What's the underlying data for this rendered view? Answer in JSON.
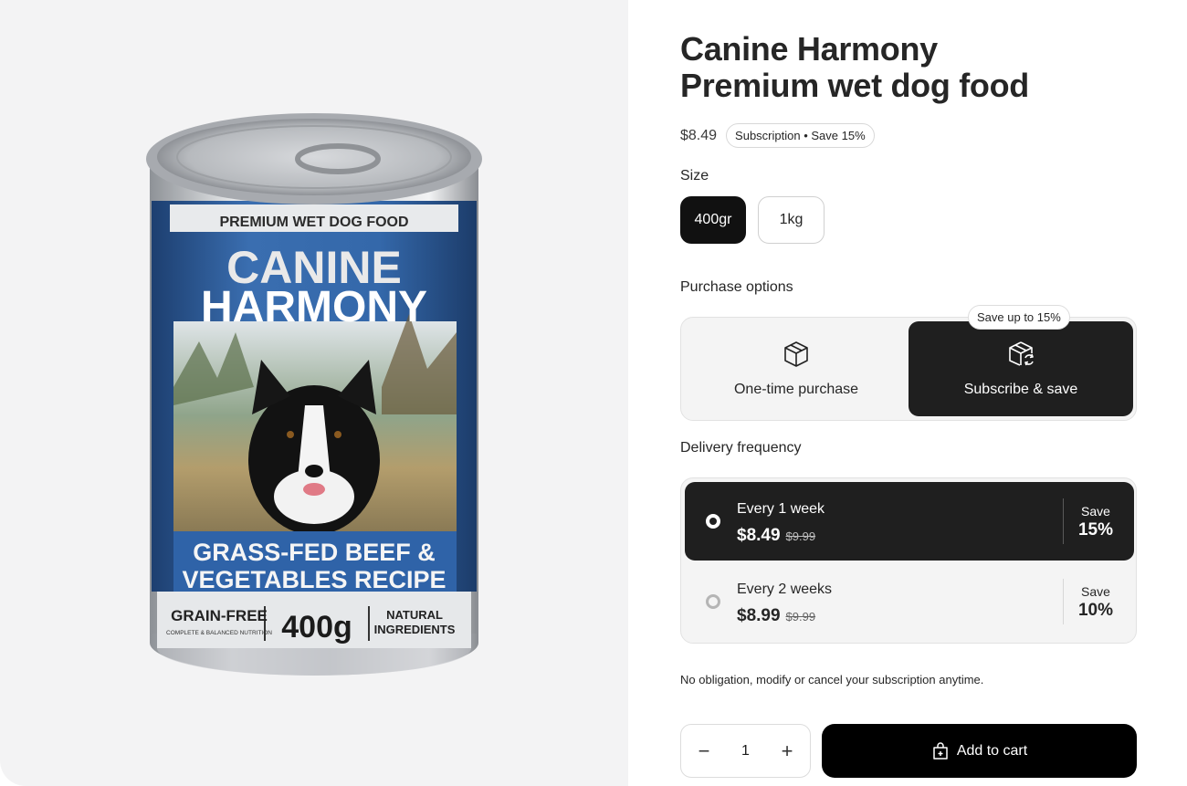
{
  "product": {
    "title_line1": "Canine Harmony",
    "title_line2": "Premium wet dog food",
    "price": "$8.49",
    "badge": "Subscription • Save 15%"
  },
  "can_label": {
    "top_text": "PREMIUM WET DOG FOOD",
    "brand_line1": "CANINE",
    "brand_line2": "HARMONY",
    "recipe_line1": "GRASS-FED BEEF &",
    "recipe_line2": "VEGETABLES RECIPE",
    "grain_free": "GRAIN-FREE",
    "complete": "COMPLETE & BALANCED NUTRITION",
    "weight": "400g",
    "natural_line1": "NATURAL",
    "natural_line2": "INGREDIENTS"
  },
  "size": {
    "label": "Size",
    "options": [
      "400gr",
      "1kg"
    ],
    "selected": "400gr"
  },
  "purchase": {
    "label": "Purchase options",
    "one_time": "One-time purchase",
    "subscribe": "Subscribe & save",
    "save_pill": "Save up to 15%",
    "selected": "Subscribe & save"
  },
  "delivery": {
    "label": "Delivery frequency",
    "options": [
      {
        "name": "Every 1 week",
        "price": "$8.49",
        "was": "$9.99",
        "save_label": "Save",
        "save_value": "15%"
      },
      {
        "name": "Every 2 weeks",
        "price": "$8.99",
        "was": "$9.99",
        "save_label": "Save",
        "save_value": "10%"
      }
    ],
    "selected": "Every 1 week"
  },
  "note": "No obligation, modify or cancel your subscription anytime.",
  "cart": {
    "quantity": "1",
    "minus": "−",
    "plus": "+",
    "add_label": "Add to cart"
  },
  "colors": {
    "accent": "#111111",
    "can_blue": "#2f5f9e",
    "panel_bg": "#f3f3f4"
  }
}
